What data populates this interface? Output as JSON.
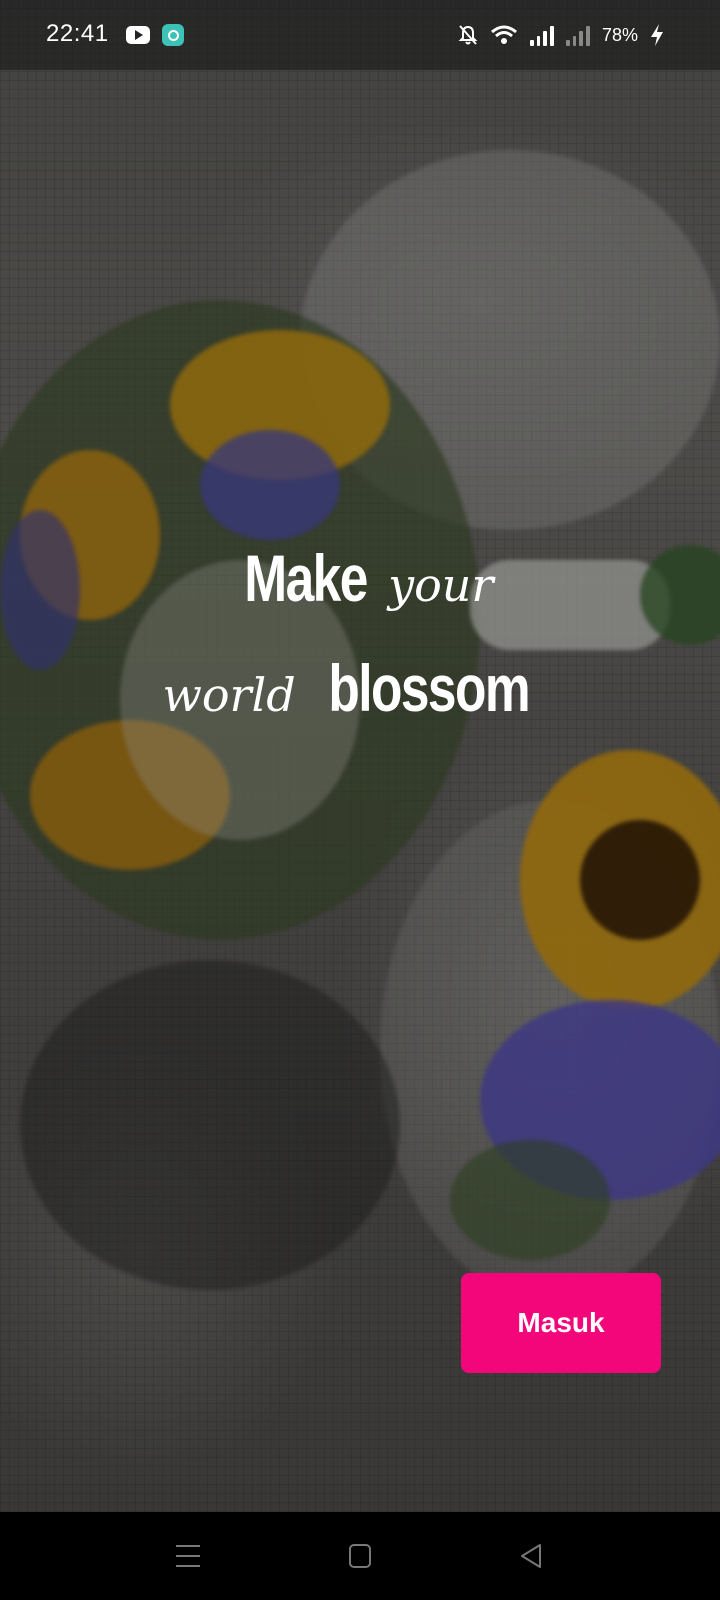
{
  "status_bar": {
    "time": "22:41",
    "battery": "78%",
    "icons": [
      "youtube-icon",
      "app-icon",
      "mute-icon",
      "wifi-icon",
      "signal-icon",
      "no-signal-icon",
      "charging-icon"
    ]
  },
  "hero": {
    "line1_bold": "Make",
    "line1_script": "your",
    "line2_script": "world",
    "line2_bold": "blossom"
  },
  "actions": {
    "login_label": "Masuk"
  },
  "colors": {
    "accent": "#f2067a",
    "text": "#ffffff"
  },
  "nav": {
    "icons": [
      "recent-apps-icon",
      "home-icon",
      "back-icon"
    ]
  }
}
